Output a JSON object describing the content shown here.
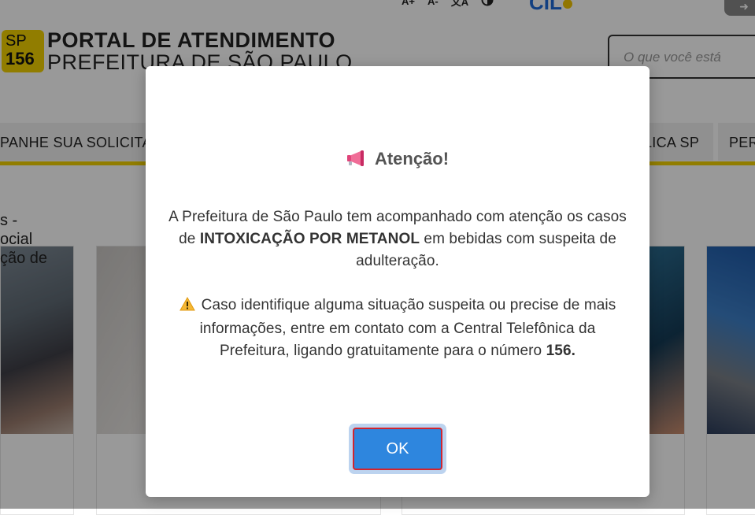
{
  "header": {
    "accessibility": {
      "font_increase": "A+",
      "font_decrease": "A-",
      "translate": "文A"
    },
    "cil_logo": "CIL",
    "logo_badge_line1": "SP",
    "logo_badge_line2": "156",
    "portal_title": "PORTAL DE ATENDIMENTO",
    "portal_subtitle": "PREFEITURA DE SÃO PAULO",
    "search_placeholder": "O que você está"
  },
  "nav": {
    "items": [
      {
        "label": "PANHE SUA SOLICITAÇÃO"
      },
      {
        "label": "LICA SP"
      },
      {
        "label": "PER"
      }
    ]
  },
  "cards": [
    {
      "text_lines": [
        "s -",
        "ocial",
        "ção de"
      ]
    }
  ],
  "modal": {
    "title": "Atenção!",
    "paragraph1_part1": "A Prefeitura de São Paulo tem acompanhado com atenção os casos de ",
    "paragraph1_bold": "INTOXICAÇÃO POR METANOL",
    "paragraph1_part2": " em bebidas com suspeita de adulteração.",
    "paragraph2_part1": "Caso identifique alguma situação suspeita ou precise de mais informações, entre em contato com a Central Telefônica da Prefeitura, ligando gratuitamente para o número ",
    "paragraph2_bold": "156.",
    "ok_label": "OK"
  },
  "colors": {
    "brand_yellow": "#f2d000",
    "ok_button": "#2e86de",
    "ok_border": "#d1252e"
  }
}
